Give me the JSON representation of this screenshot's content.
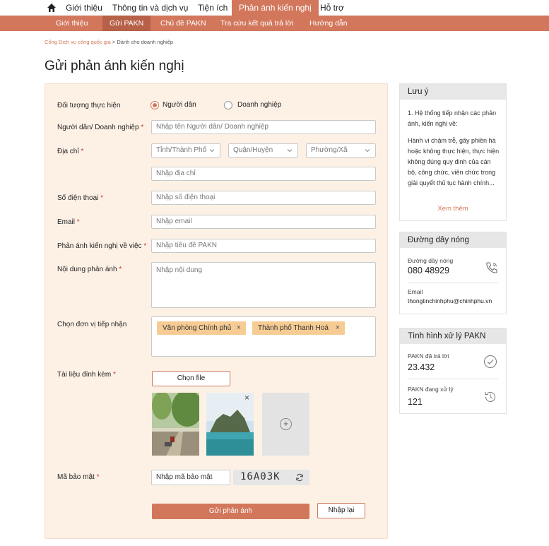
{
  "top_nav": {
    "items": [
      "Giới thiệu",
      "Thông tin và dịch vụ",
      "Tiện ích",
      "Phản ánh kiến nghị",
      "Hỗ trợ"
    ],
    "active_index": 3
  },
  "sub_nav": {
    "items": [
      "Giới thiệu",
      "Gửi PAKN",
      "Chủ đề PAKN",
      "Tra cứu kết quả trả lời",
      "Hướng dẫn"
    ],
    "active_index": 1
  },
  "breadcrumb": {
    "link": "Cổng Dịch vụ công quốc gia",
    "separator": ">",
    "current": "Dành cho doanh nghiệp"
  },
  "page_title": "Gửi phản ánh kiến nghị",
  "form": {
    "subject_type": {
      "label": "Đối tượng thực hiện",
      "options": [
        "Người dân",
        "Doanh nghiệp"
      ],
      "selected_index": 0
    },
    "name": {
      "label": "Người dân/ Doanh nghiệp",
      "required": "*",
      "placeholder": "Nhập tên Người dân/ Doanh nghiệp"
    },
    "address": {
      "label": "Địa chỉ",
      "required": "*",
      "province": "Tỉnh/Thành Phố",
      "district": "Quận/Huyện",
      "ward": "Phường/Xã",
      "detail_placeholder": "Nhập địa chỉ"
    },
    "phone": {
      "label": "Số điện thoại",
      "required": "*",
      "placeholder": "Nhập số điện thoại"
    },
    "email": {
      "label": "Email",
      "required": "*",
      "placeholder": "Nhập email"
    },
    "topic": {
      "label": "Phản ánh kiến nghị về việc",
      "required": "*",
      "placeholder": "Nhập tiêu đề PAKN"
    },
    "content": {
      "label": "Nội dung phản ánh",
      "required": "*",
      "placeholder": "Nhập nội dung"
    },
    "receiver": {
      "label": "Chọn đơn vị tiếp nhận",
      "tags": [
        "Văn phòng Chính phủ",
        "Thành phố Thanh Hoá"
      ],
      "remove_glyph": "×"
    },
    "attachments": {
      "label": "Tài liệu đính kèm",
      "required": "*",
      "button": "Chọn file",
      "remove_glyph": "×",
      "add_glyph": "+"
    },
    "captcha": {
      "label": "Mã bảo mật",
      "required": "*",
      "placeholder": "Nhập mã bảo mật",
      "code": "16A03K"
    },
    "submit_label": "Gửi phản ánh",
    "reset_label": "Nhập lại"
  },
  "sidebar": {
    "note": {
      "title": "Lưu ý",
      "line1": "1. Hệ thống tiếp nhận các phản ánh, kiến nghị về:",
      "line2": "Hành vi chậm trễ, gây phiền hà hoặc không thực hiện, thực hiện không đúng quy định của cán bộ, công chức, viên chức trong giải quyết thủ tục hành chính...",
      "more": "Xem thêm"
    },
    "hotline": {
      "title": "Đường dây nóng",
      "phone_label": "Đường dây nóng",
      "phone": "080 48929",
      "email_label": "Email",
      "email": "thongtinchinhphu@chinhphu.vn"
    },
    "status": {
      "title": "Tình hình xử lý PAKN",
      "answered_label": "PAKN đã trả lời",
      "answered": "23.432",
      "processing_label": "PAKN đang xử lý",
      "processing": "121"
    }
  },
  "colors": {
    "accent": "#d2775c",
    "accent_dark": "#b66148",
    "form_bg": "#fdf1e6",
    "tag_bg": "#f6cc94"
  }
}
